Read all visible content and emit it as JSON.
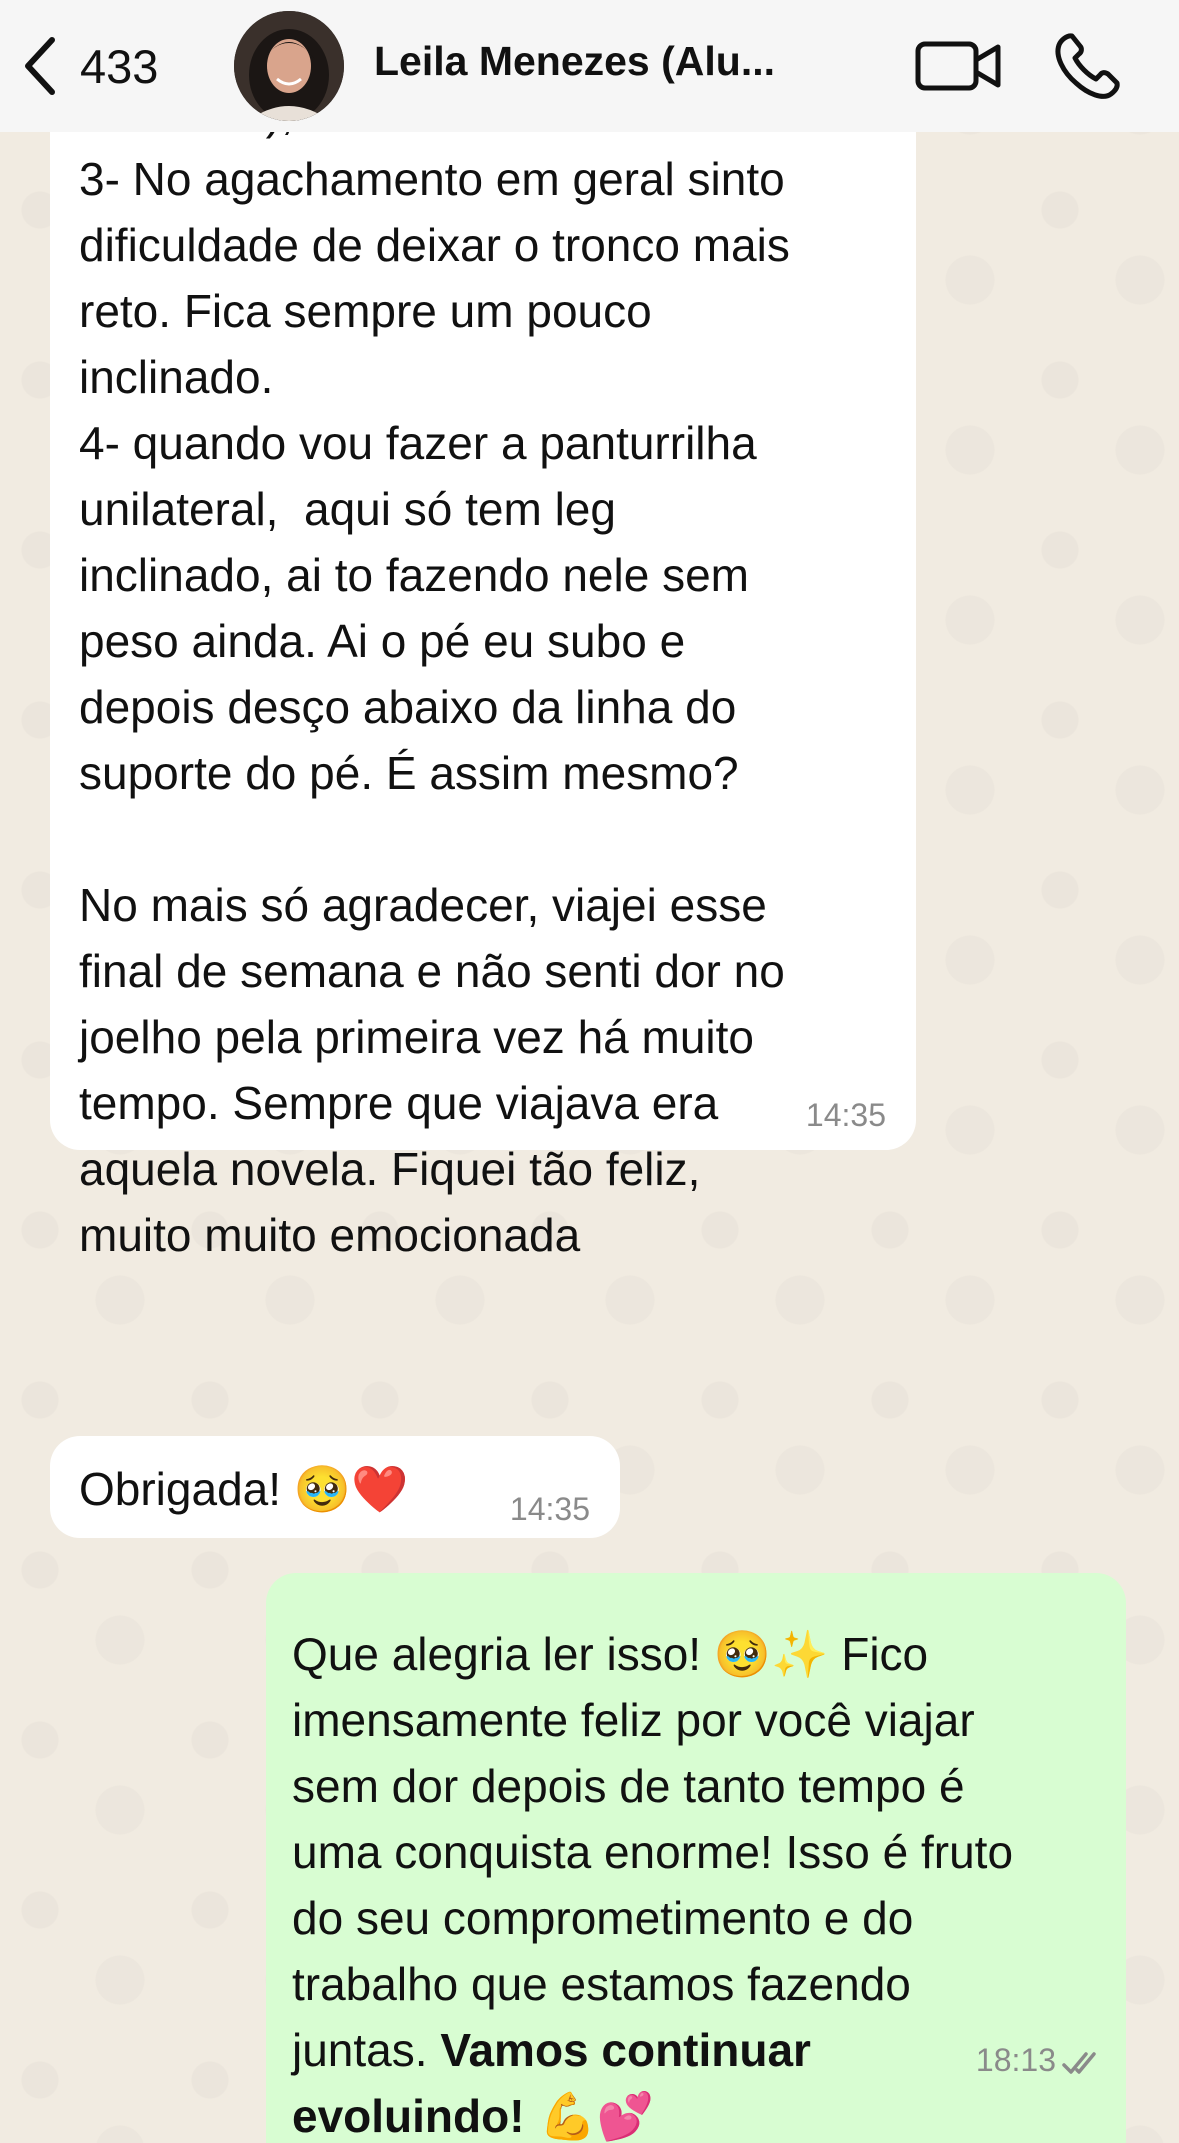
{
  "header": {
    "unread_count": "433",
    "contact_name": "Leila Menezes (Alu..."
  },
  "messages": [
    {
      "direction": "incoming",
      "text": "malhar c meu namorado e peço pra\nele filmar), mas não sinto dor.\n3- No agachamento em geral sinto\ndificuldade de deixar o tronco mais\nreto. Fica sempre um pouco\ninclinado.\n4- quando vou fazer a panturrilha\nunilateral,  aqui só tem leg\ninclinado, ai to fazendo nele sem\npeso ainda. Ai o pé eu subo e\ndepois desço abaixo da linha do\nsuporte do pé. É assim mesmo?\n\nNo mais só agradecer, viajei esse\nfinal de semana e não senti dor no\njoelho pela primeira vez há muito\ntempo. Sempre que viajava era\naquela novela. Fiquei tão feliz,\nmuito muito emocionada",
      "time": "14:35"
    },
    {
      "direction": "incoming",
      "text": "Obrigada!",
      "emojis": "🥹❤️",
      "time": "14:35"
    },
    {
      "direction": "outgoing",
      "text_before": "Que alegria ler isso! ",
      "emoji_1": "🥹✨",
      "text_middle": " Fico\nimensamente feliz por você viajar\nsem dor depois de tanto tempo é\numa conquista enorme! Isso é fruto\ndo seu comprometimento e do\ntrabalho que estamos fazendo\njuntas. ",
      "text_bold": "Vamos continuar\nevoluindo!",
      "emoji_2": " 💪💕",
      "time": "18:13",
      "status": "read"
    }
  ],
  "colors": {
    "wallpaper": "#f1ebe1",
    "header_bg": "#f6f6f6",
    "incoming_bubble": "#ffffff",
    "outgoing_bubble": "#d8fdd2",
    "read_receipt": "#8a8a8a"
  }
}
